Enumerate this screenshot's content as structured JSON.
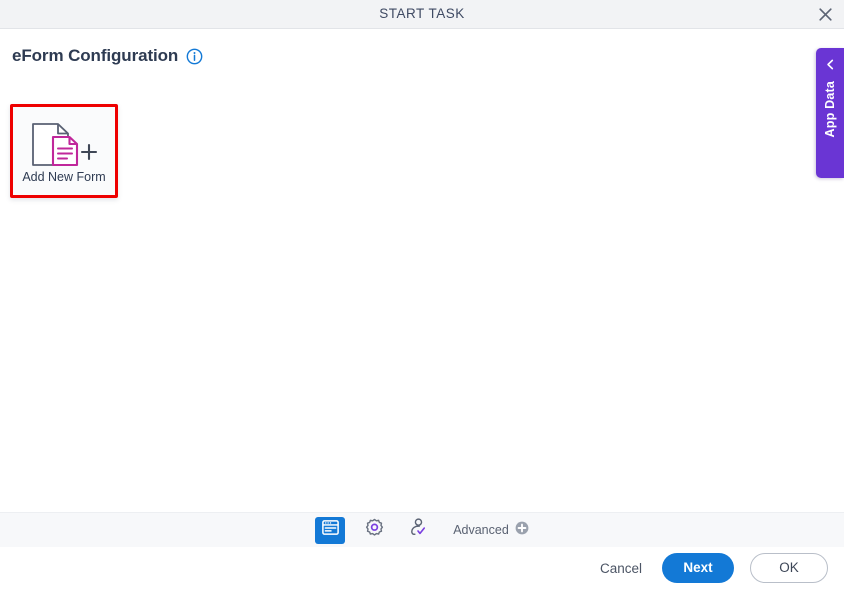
{
  "window": {
    "title": "START TASK",
    "close_icon": "close-icon"
  },
  "page": {
    "title": "eForm Configuration",
    "info_icon": "info-icon"
  },
  "content": {
    "cards": [
      {
        "label": "Add New Form",
        "icon": "add-document-icon",
        "selected": true
      }
    ]
  },
  "app_data_tab": {
    "label": "App Data",
    "chevron_icon": "chevron-left-icon",
    "color": "#6a35d4"
  },
  "toolbar": {
    "items": [
      {
        "name": "form-designer",
        "icon": "form-window-icon",
        "active": true
      },
      {
        "name": "settings",
        "icon": "gear-icon",
        "active": false
      },
      {
        "name": "participants",
        "icon": "user-check-icon",
        "active": false
      }
    ],
    "advanced_label": "Advanced",
    "advanced_icon": "plus-circle-icon"
  },
  "actions": {
    "cancel_label": "Cancel",
    "next_label": "Next",
    "ok_label": "OK"
  },
  "colors": {
    "accent_blue": "#1379d6",
    "accent_purple": "#6a35d4",
    "accent_magenta": "#c0279b",
    "highlight_red": "#ee0000",
    "title_text": "#3f4a63"
  }
}
